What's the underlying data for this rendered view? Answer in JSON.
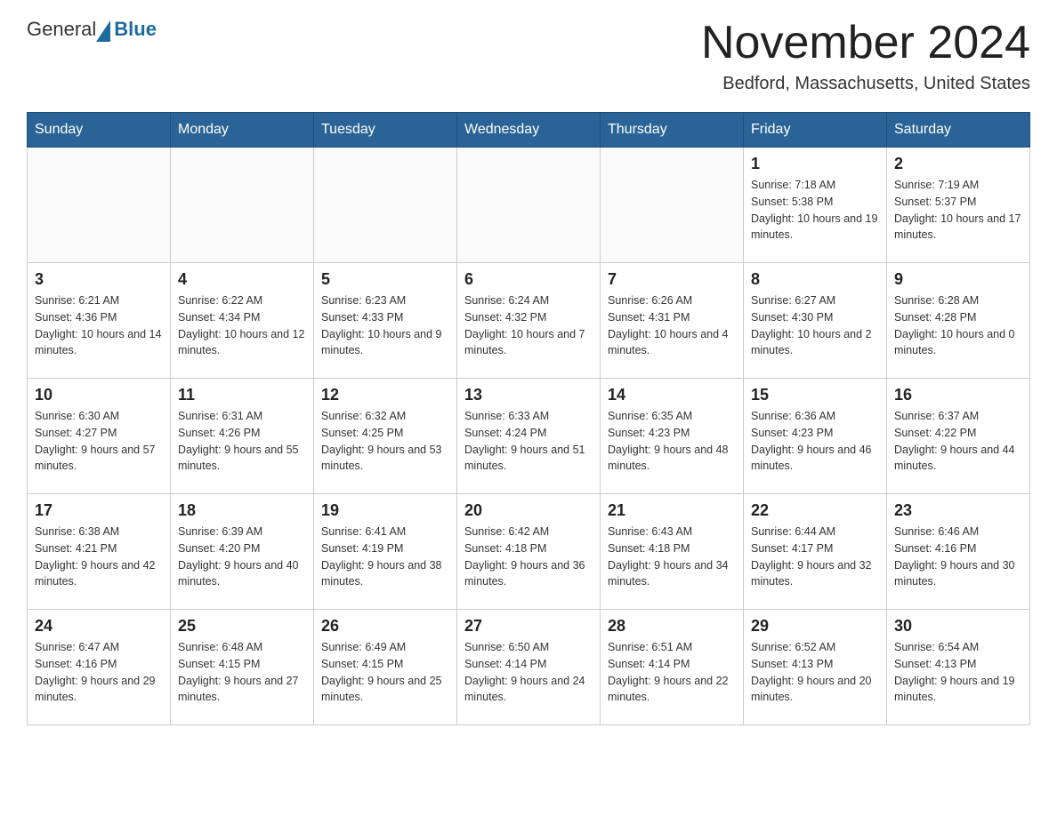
{
  "logo": {
    "general": "General",
    "blue": "Blue"
  },
  "title": "November 2024",
  "subtitle": "Bedford, Massachusetts, United States",
  "headers": [
    "Sunday",
    "Monday",
    "Tuesday",
    "Wednesday",
    "Thursday",
    "Friday",
    "Saturday"
  ],
  "weeks": [
    [
      {
        "day": "",
        "info": ""
      },
      {
        "day": "",
        "info": ""
      },
      {
        "day": "",
        "info": ""
      },
      {
        "day": "",
        "info": ""
      },
      {
        "day": "",
        "info": ""
      },
      {
        "day": "1",
        "info": "Sunrise: 7:18 AM\nSunset: 5:38 PM\nDaylight: 10 hours and 19 minutes."
      },
      {
        "day": "2",
        "info": "Sunrise: 7:19 AM\nSunset: 5:37 PM\nDaylight: 10 hours and 17 minutes."
      }
    ],
    [
      {
        "day": "3",
        "info": "Sunrise: 6:21 AM\nSunset: 4:36 PM\nDaylight: 10 hours and 14 minutes."
      },
      {
        "day": "4",
        "info": "Sunrise: 6:22 AM\nSunset: 4:34 PM\nDaylight: 10 hours and 12 minutes."
      },
      {
        "day": "5",
        "info": "Sunrise: 6:23 AM\nSunset: 4:33 PM\nDaylight: 10 hours and 9 minutes."
      },
      {
        "day": "6",
        "info": "Sunrise: 6:24 AM\nSunset: 4:32 PM\nDaylight: 10 hours and 7 minutes."
      },
      {
        "day": "7",
        "info": "Sunrise: 6:26 AM\nSunset: 4:31 PM\nDaylight: 10 hours and 4 minutes."
      },
      {
        "day": "8",
        "info": "Sunrise: 6:27 AM\nSunset: 4:30 PM\nDaylight: 10 hours and 2 minutes."
      },
      {
        "day": "9",
        "info": "Sunrise: 6:28 AM\nSunset: 4:28 PM\nDaylight: 10 hours and 0 minutes."
      }
    ],
    [
      {
        "day": "10",
        "info": "Sunrise: 6:30 AM\nSunset: 4:27 PM\nDaylight: 9 hours and 57 minutes."
      },
      {
        "day": "11",
        "info": "Sunrise: 6:31 AM\nSunset: 4:26 PM\nDaylight: 9 hours and 55 minutes."
      },
      {
        "day": "12",
        "info": "Sunrise: 6:32 AM\nSunset: 4:25 PM\nDaylight: 9 hours and 53 minutes."
      },
      {
        "day": "13",
        "info": "Sunrise: 6:33 AM\nSunset: 4:24 PM\nDaylight: 9 hours and 51 minutes."
      },
      {
        "day": "14",
        "info": "Sunrise: 6:35 AM\nSunset: 4:23 PM\nDaylight: 9 hours and 48 minutes."
      },
      {
        "day": "15",
        "info": "Sunrise: 6:36 AM\nSunset: 4:23 PM\nDaylight: 9 hours and 46 minutes."
      },
      {
        "day": "16",
        "info": "Sunrise: 6:37 AM\nSunset: 4:22 PM\nDaylight: 9 hours and 44 minutes."
      }
    ],
    [
      {
        "day": "17",
        "info": "Sunrise: 6:38 AM\nSunset: 4:21 PM\nDaylight: 9 hours and 42 minutes."
      },
      {
        "day": "18",
        "info": "Sunrise: 6:39 AM\nSunset: 4:20 PM\nDaylight: 9 hours and 40 minutes."
      },
      {
        "day": "19",
        "info": "Sunrise: 6:41 AM\nSunset: 4:19 PM\nDaylight: 9 hours and 38 minutes."
      },
      {
        "day": "20",
        "info": "Sunrise: 6:42 AM\nSunset: 4:18 PM\nDaylight: 9 hours and 36 minutes."
      },
      {
        "day": "21",
        "info": "Sunrise: 6:43 AM\nSunset: 4:18 PM\nDaylight: 9 hours and 34 minutes."
      },
      {
        "day": "22",
        "info": "Sunrise: 6:44 AM\nSunset: 4:17 PM\nDaylight: 9 hours and 32 minutes."
      },
      {
        "day": "23",
        "info": "Sunrise: 6:46 AM\nSunset: 4:16 PM\nDaylight: 9 hours and 30 minutes."
      }
    ],
    [
      {
        "day": "24",
        "info": "Sunrise: 6:47 AM\nSunset: 4:16 PM\nDaylight: 9 hours and 29 minutes."
      },
      {
        "day": "25",
        "info": "Sunrise: 6:48 AM\nSunset: 4:15 PM\nDaylight: 9 hours and 27 minutes."
      },
      {
        "day": "26",
        "info": "Sunrise: 6:49 AM\nSunset: 4:15 PM\nDaylight: 9 hours and 25 minutes."
      },
      {
        "day": "27",
        "info": "Sunrise: 6:50 AM\nSunset: 4:14 PM\nDaylight: 9 hours and 24 minutes."
      },
      {
        "day": "28",
        "info": "Sunrise: 6:51 AM\nSunset: 4:14 PM\nDaylight: 9 hours and 22 minutes."
      },
      {
        "day": "29",
        "info": "Sunrise: 6:52 AM\nSunset: 4:13 PM\nDaylight: 9 hours and 20 minutes."
      },
      {
        "day": "30",
        "info": "Sunrise: 6:54 AM\nSunset: 4:13 PM\nDaylight: 9 hours and 19 minutes."
      }
    ]
  ]
}
